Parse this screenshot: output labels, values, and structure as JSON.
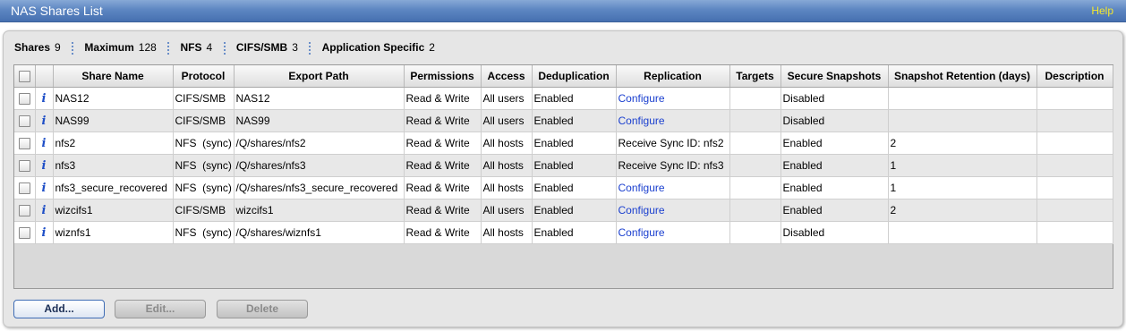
{
  "header": {
    "title": "NAS Shares List",
    "help": "Help"
  },
  "summary": [
    {
      "label": "Shares",
      "value": "9"
    },
    {
      "label": "Maximum",
      "value": "128"
    },
    {
      "label": "NFS",
      "value": "4"
    },
    {
      "label": "CIFS/SMB",
      "value": "3"
    },
    {
      "label": "Application Specific",
      "value": "2"
    }
  ],
  "columns": [
    "",
    "",
    "Share Name",
    "Protocol",
    "Export Path",
    "Permissions",
    "Access",
    "Deduplication",
    "Replication",
    "Targets",
    "Secure Snapshots",
    "Snapshot Retention (days)",
    "Description"
  ],
  "rows": [
    {
      "name": "NAS12",
      "protocol": "CIFS/SMB",
      "path": "NAS12",
      "permissions": "Read & Write",
      "access": "All users",
      "dedup": "Enabled",
      "replication": "Configure",
      "replication_link": true,
      "targets": "",
      "secure": "Disabled",
      "retention": "",
      "description": ""
    },
    {
      "name": "NAS99",
      "protocol": "CIFS/SMB",
      "path": "NAS99",
      "permissions": "Read & Write",
      "access": "All users",
      "dedup": "Enabled",
      "replication": "Configure",
      "replication_link": true,
      "targets": "",
      "secure": "Disabled",
      "retention": "",
      "description": ""
    },
    {
      "name": "nfs2",
      "protocol": "NFS  (sync)",
      "path": "/Q/shares/nfs2",
      "permissions": "Read & Write",
      "access": "All hosts",
      "dedup": "Enabled",
      "replication": "Receive Sync ID: nfs2",
      "replication_link": false,
      "targets": "",
      "secure": "Enabled",
      "retention": "2",
      "description": ""
    },
    {
      "name": "nfs3",
      "protocol": "NFS  (sync)",
      "path": "/Q/shares/nfs3",
      "permissions": "Read & Write",
      "access": "All hosts",
      "dedup": "Enabled",
      "replication": "Receive Sync ID: nfs3",
      "replication_link": false,
      "targets": "",
      "secure": "Enabled",
      "retention": "1",
      "description": ""
    },
    {
      "name": "nfs3_secure_recovered",
      "protocol": "NFS  (sync)",
      "path": "/Q/shares/nfs3_secure_recovered",
      "permissions": "Read & Write",
      "access": "All hosts",
      "dedup": "Enabled",
      "replication": "Configure",
      "replication_link": true,
      "targets": "",
      "secure": "Enabled",
      "retention": "1",
      "description": ""
    },
    {
      "name": "wizcifs1",
      "protocol": "CIFS/SMB",
      "path": "wizcifs1",
      "permissions": "Read & Write",
      "access": "All users",
      "dedup": "Enabled",
      "replication": "Configure",
      "replication_link": true,
      "targets": "",
      "secure": "Enabled",
      "retention": "2",
      "description": ""
    },
    {
      "name": "wiznfs1",
      "protocol": "NFS  (sync)",
      "path": "/Q/shares/wiznfs1",
      "permissions": "Read & Write",
      "access": "All hosts",
      "dedup": "Enabled",
      "replication": "Configure",
      "replication_link": true,
      "targets": "",
      "secure": "Disabled",
      "retention": "",
      "description": ""
    }
  ],
  "buttons": [
    {
      "name": "add-button",
      "label": "Add...",
      "enabled": true
    },
    {
      "name": "edit-button",
      "label": "Edit...",
      "enabled": false
    },
    {
      "name": "delete-button",
      "label": "Delete",
      "enabled": false
    }
  ],
  "icons": {
    "row_info": "info-icon",
    "checkbox": "checkbox-icon"
  },
  "colors": {
    "header_bar": "#5d86c2",
    "help_link": "#f5e82c",
    "link": "#1a3fcf",
    "info_icon": "#1f4fc7"
  }
}
